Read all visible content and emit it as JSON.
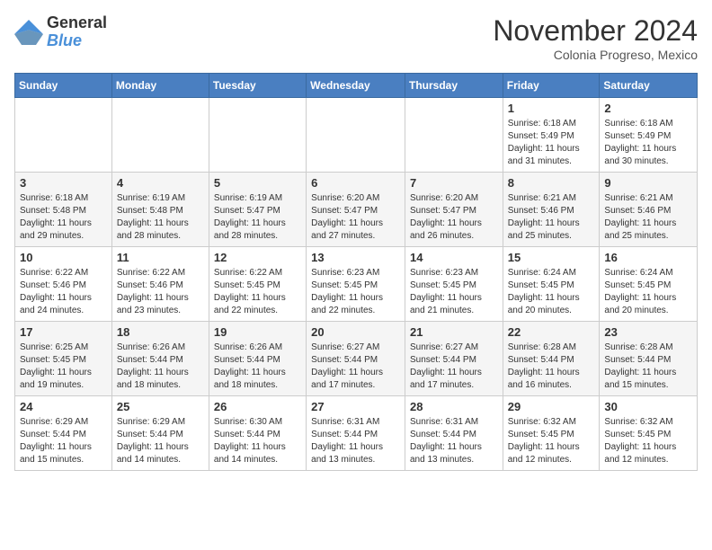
{
  "logo": {
    "line1": "General",
    "line2": "Blue"
  },
  "calendar": {
    "month_title": "November 2024",
    "subtitle": "Colonia Progreso, Mexico",
    "days_of_week": [
      "Sunday",
      "Monday",
      "Tuesday",
      "Wednesday",
      "Thursday",
      "Friday",
      "Saturday"
    ],
    "weeks": [
      [
        {
          "day": "",
          "info": ""
        },
        {
          "day": "",
          "info": ""
        },
        {
          "day": "",
          "info": ""
        },
        {
          "day": "",
          "info": ""
        },
        {
          "day": "",
          "info": ""
        },
        {
          "day": "1",
          "info": "Sunrise: 6:18 AM\nSunset: 5:49 PM\nDaylight: 11 hours and 31 minutes."
        },
        {
          "day": "2",
          "info": "Sunrise: 6:18 AM\nSunset: 5:49 PM\nDaylight: 11 hours and 30 minutes."
        }
      ],
      [
        {
          "day": "3",
          "info": "Sunrise: 6:18 AM\nSunset: 5:48 PM\nDaylight: 11 hours and 29 minutes."
        },
        {
          "day": "4",
          "info": "Sunrise: 6:19 AM\nSunset: 5:48 PM\nDaylight: 11 hours and 28 minutes."
        },
        {
          "day": "5",
          "info": "Sunrise: 6:19 AM\nSunset: 5:47 PM\nDaylight: 11 hours and 28 minutes."
        },
        {
          "day": "6",
          "info": "Sunrise: 6:20 AM\nSunset: 5:47 PM\nDaylight: 11 hours and 27 minutes."
        },
        {
          "day": "7",
          "info": "Sunrise: 6:20 AM\nSunset: 5:47 PM\nDaylight: 11 hours and 26 minutes."
        },
        {
          "day": "8",
          "info": "Sunrise: 6:21 AM\nSunset: 5:46 PM\nDaylight: 11 hours and 25 minutes."
        },
        {
          "day": "9",
          "info": "Sunrise: 6:21 AM\nSunset: 5:46 PM\nDaylight: 11 hours and 25 minutes."
        }
      ],
      [
        {
          "day": "10",
          "info": "Sunrise: 6:22 AM\nSunset: 5:46 PM\nDaylight: 11 hours and 24 minutes."
        },
        {
          "day": "11",
          "info": "Sunrise: 6:22 AM\nSunset: 5:46 PM\nDaylight: 11 hours and 23 minutes."
        },
        {
          "day": "12",
          "info": "Sunrise: 6:22 AM\nSunset: 5:45 PM\nDaylight: 11 hours and 22 minutes."
        },
        {
          "day": "13",
          "info": "Sunrise: 6:23 AM\nSunset: 5:45 PM\nDaylight: 11 hours and 22 minutes."
        },
        {
          "day": "14",
          "info": "Sunrise: 6:23 AM\nSunset: 5:45 PM\nDaylight: 11 hours and 21 minutes."
        },
        {
          "day": "15",
          "info": "Sunrise: 6:24 AM\nSunset: 5:45 PM\nDaylight: 11 hours and 20 minutes."
        },
        {
          "day": "16",
          "info": "Sunrise: 6:24 AM\nSunset: 5:45 PM\nDaylight: 11 hours and 20 minutes."
        }
      ],
      [
        {
          "day": "17",
          "info": "Sunrise: 6:25 AM\nSunset: 5:45 PM\nDaylight: 11 hours and 19 minutes."
        },
        {
          "day": "18",
          "info": "Sunrise: 6:26 AM\nSunset: 5:44 PM\nDaylight: 11 hours and 18 minutes."
        },
        {
          "day": "19",
          "info": "Sunrise: 6:26 AM\nSunset: 5:44 PM\nDaylight: 11 hours and 18 minutes."
        },
        {
          "day": "20",
          "info": "Sunrise: 6:27 AM\nSunset: 5:44 PM\nDaylight: 11 hours and 17 minutes."
        },
        {
          "day": "21",
          "info": "Sunrise: 6:27 AM\nSunset: 5:44 PM\nDaylight: 11 hours and 17 minutes."
        },
        {
          "day": "22",
          "info": "Sunrise: 6:28 AM\nSunset: 5:44 PM\nDaylight: 11 hours and 16 minutes."
        },
        {
          "day": "23",
          "info": "Sunrise: 6:28 AM\nSunset: 5:44 PM\nDaylight: 11 hours and 15 minutes."
        }
      ],
      [
        {
          "day": "24",
          "info": "Sunrise: 6:29 AM\nSunset: 5:44 PM\nDaylight: 11 hours and 15 minutes."
        },
        {
          "day": "25",
          "info": "Sunrise: 6:29 AM\nSunset: 5:44 PM\nDaylight: 11 hours and 14 minutes."
        },
        {
          "day": "26",
          "info": "Sunrise: 6:30 AM\nSunset: 5:44 PM\nDaylight: 11 hours and 14 minutes."
        },
        {
          "day": "27",
          "info": "Sunrise: 6:31 AM\nSunset: 5:44 PM\nDaylight: 11 hours and 13 minutes."
        },
        {
          "day": "28",
          "info": "Sunrise: 6:31 AM\nSunset: 5:44 PM\nDaylight: 11 hours and 13 minutes."
        },
        {
          "day": "29",
          "info": "Sunrise: 6:32 AM\nSunset: 5:45 PM\nDaylight: 11 hours and 12 minutes."
        },
        {
          "day": "30",
          "info": "Sunrise: 6:32 AM\nSunset: 5:45 PM\nDaylight: 11 hours and 12 minutes."
        }
      ]
    ]
  }
}
